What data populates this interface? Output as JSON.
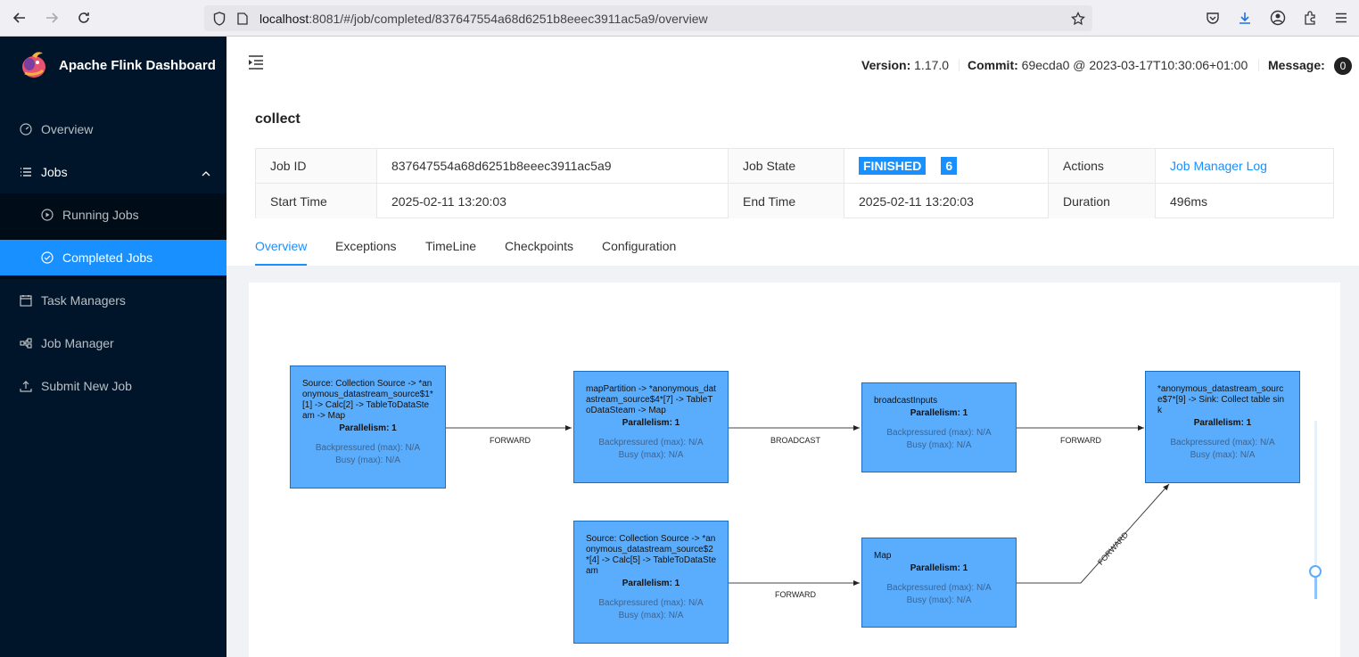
{
  "browser": {
    "url_host": "localhost",
    "url_rest": ":8081/#/job/completed/837647554a68d6251b8eeec3911ac5a9/overview"
  },
  "sidebar": {
    "brand": "Apache Flink Dashboard",
    "items": [
      {
        "label": "Overview"
      },
      {
        "label": "Jobs"
      },
      {
        "label": "Running Jobs"
      },
      {
        "label": "Completed Jobs"
      },
      {
        "label": "Task Managers"
      },
      {
        "label": "Job Manager"
      },
      {
        "label": "Submit New Job"
      }
    ]
  },
  "header": {
    "version_label": "Version:",
    "version": "1.17.0",
    "commit_label": "Commit:",
    "commit": "69ecda0 @ 2023-03-17T10:30:06+01:00",
    "message_label": "Message:",
    "message_count": "0"
  },
  "job": {
    "name": "collect",
    "id_label": "Job ID",
    "id": "837647554a68d6251b8eeec3911ac5a9",
    "state_label": "Job State",
    "state": "FINISHED",
    "task_count": "6",
    "actions_label": "Actions",
    "actions_link": "Job Manager Log",
    "start_label": "Start Time",
    "start": "2025-02-11 13:20:03",
    "end_label": "End Time",
    "end": "2025-02-11 13:20:03",
    "duration_label": "Duration",
    "duration": "496ms"
  },
  "tabs": [
    "Overview",
    "Exceptions",
    "TimeLine",
    "Checkpoints",
    "Configuration"
  ],
  "graph": {
    "nodes": [
      {
        "name": "Source: Collection Source -> *anonymous_datastream_source$1*[1] -> Calc[2] -> TableToDataSteam -> Map",
        "parallelism": "Parallelism: 1",
        "backpressured": "Backpressured (max): N/A",
        "busy": "Busy (max): N/A"
      },
      {
        "name": "mapPartition -> *anonymous_datastream_source$4*[7] -> TableToDataSteam -> Map",
        "parallelism": "Parallelism: 1",
        "backpressured": "Backpressured (max): N/A",
        "busy": "Busy (max): N/A"
      },
      {
        "name": "broadcastInputs",
        "parallelism": "Parallelism: 1",
        "backpressured": "Backpressured (max): N/A",
        "busy": "Busy (max): N/A"
      },
      {
        "name": "*anonymous_datastream_source$7*[9] -> Sink: Collect table sink",
        "parallelism": "Parallelism: 1",
        "backpressured": "Backpressured (max): N/A",
        "busy": "Busy (max): N/A"
      },
      {
        "name": "Source: Collection Source -> *anonymous_datastream_source$2*[4] -> Calc[5] -> TableToDataSteam",
        "parallelism": "Parallelism: 1",
        "backpressured": "Backpressured (max): N/A",
        "busy": "Busy (max): N/A"
      },
      {
        "name": "Map",
        "parallelism": "Parallelism: 1",
        "backpressured": "Backpressured (max): N/A",
        "busy": "Busy (max): N/A"
      }
    ],
    "edges": [
      "FORWARD",
      "BROADCAST",
      "FORWARD",
      "FORWARD",
      "FORWARD"
    ]
  },
  "colors": {
    "sidebar_bg": "#001529",
    "accent": "#1890ff",
    "node_fill": "#5aacfc"
  }
}
